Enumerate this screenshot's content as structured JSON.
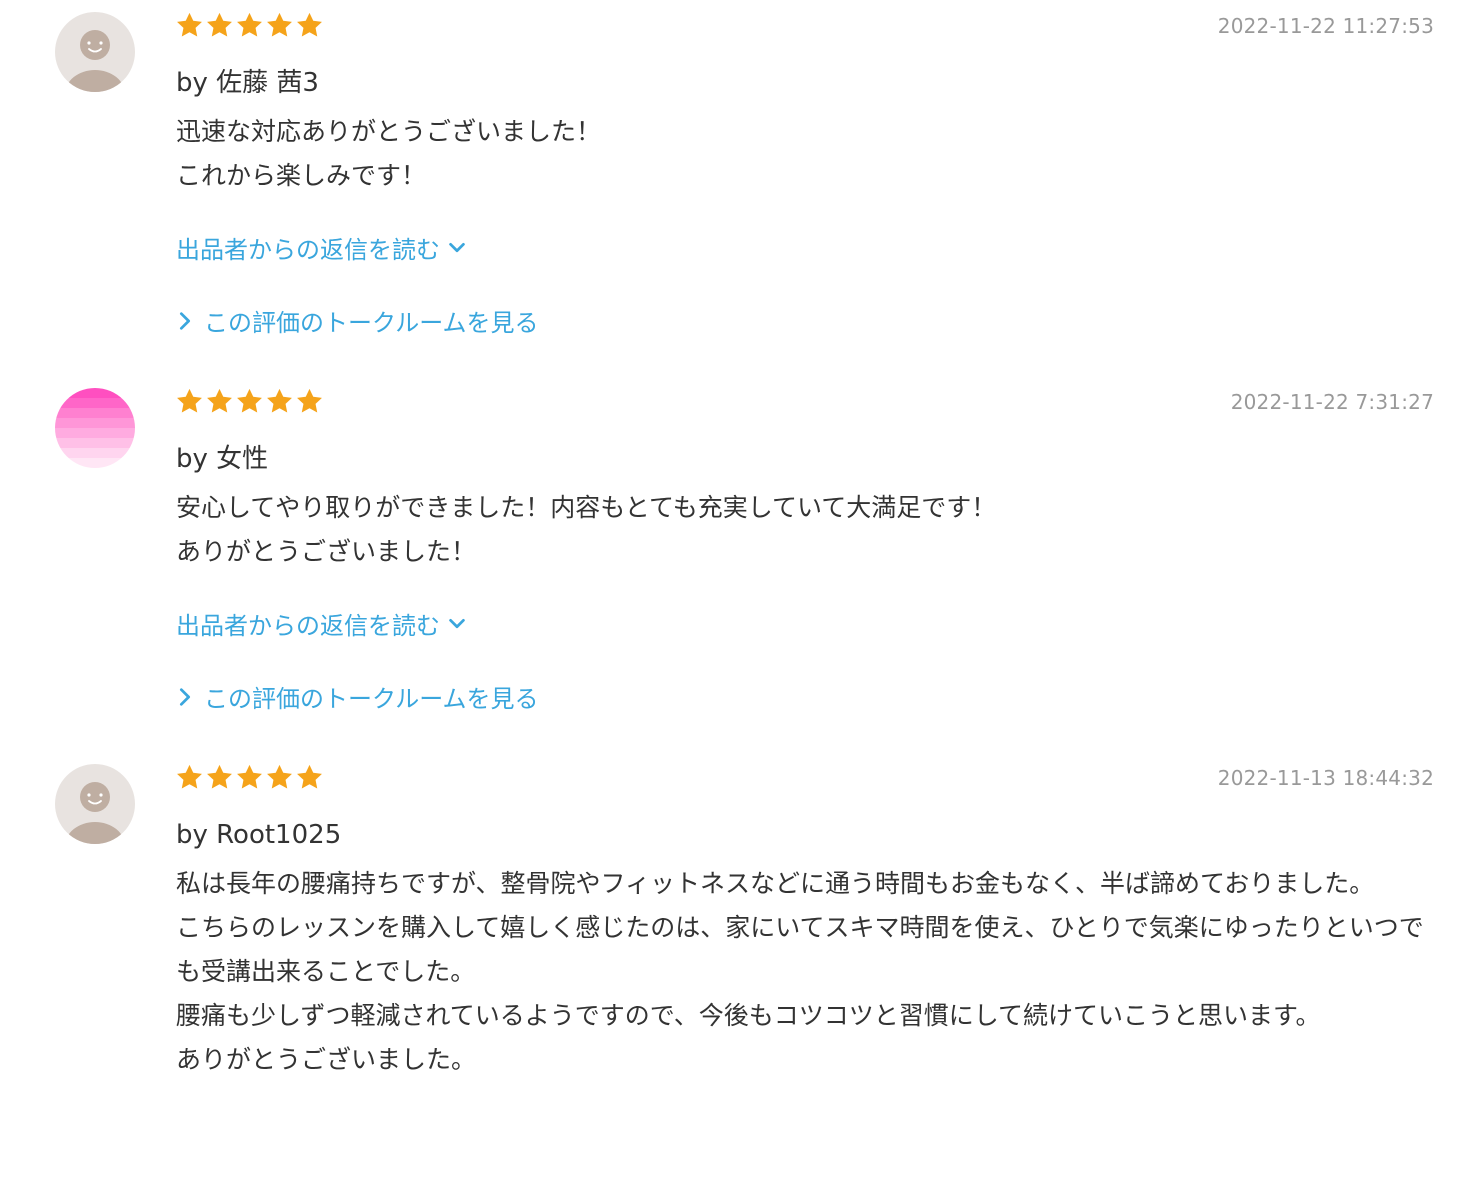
{
  "reviews": [
    {
      "avatar": "default-face-avatar",
      "rating": 5,
      "date": "2022-11-22 11:27:53",
      "author": "by 佐藤 茜3",
      "body": "迅速な対応ありがとうございました！\nこれから楽しみです！",
      "reply_link": "出品者からの返信を読む",
      "talk_link": "この評価のトークルームを見る"
    },
    {
      "avatar": "pink-gradient-avatar",
      "rating": 5,
      "date": "2022-11-22 7:31:27",
      "author": "by 女性",
      "body": "安心してやり取りができました！内容もとても充実していて大満足です！\nありがとうございました！",
      "reply_link": "出品者からの返信を読む",
      "talk_link": "この評価のトークルームを見る"
    },
    {
      "avatar": "default-face-avatar",
      "rating": 5,
      "date": "2022-11-13 18:44:32",
      "author": "by Root1025",
      "body": "私は長年の腰痛持ちですが、整骨院やフィットネスなどに通う時間もお金もなく、半ば諦めておりました。\nこちらのレッスンを購入して嬉しく感じたのは、家にいてスキマ時間を使え、ひとりで気楽にゆったりといつでも受講出来ることでした。\n腰痛も少しずつ軽減されているようですので、今後もコツコツと習慣にして続けていこうと思います。\nありがとうございました。"
    }
  ],
  "colors": {
    "star": "#f5a31a",
    "link": "#3aa6dd",
    "date": "#999999",
    "text": "#333333"
  }
}
